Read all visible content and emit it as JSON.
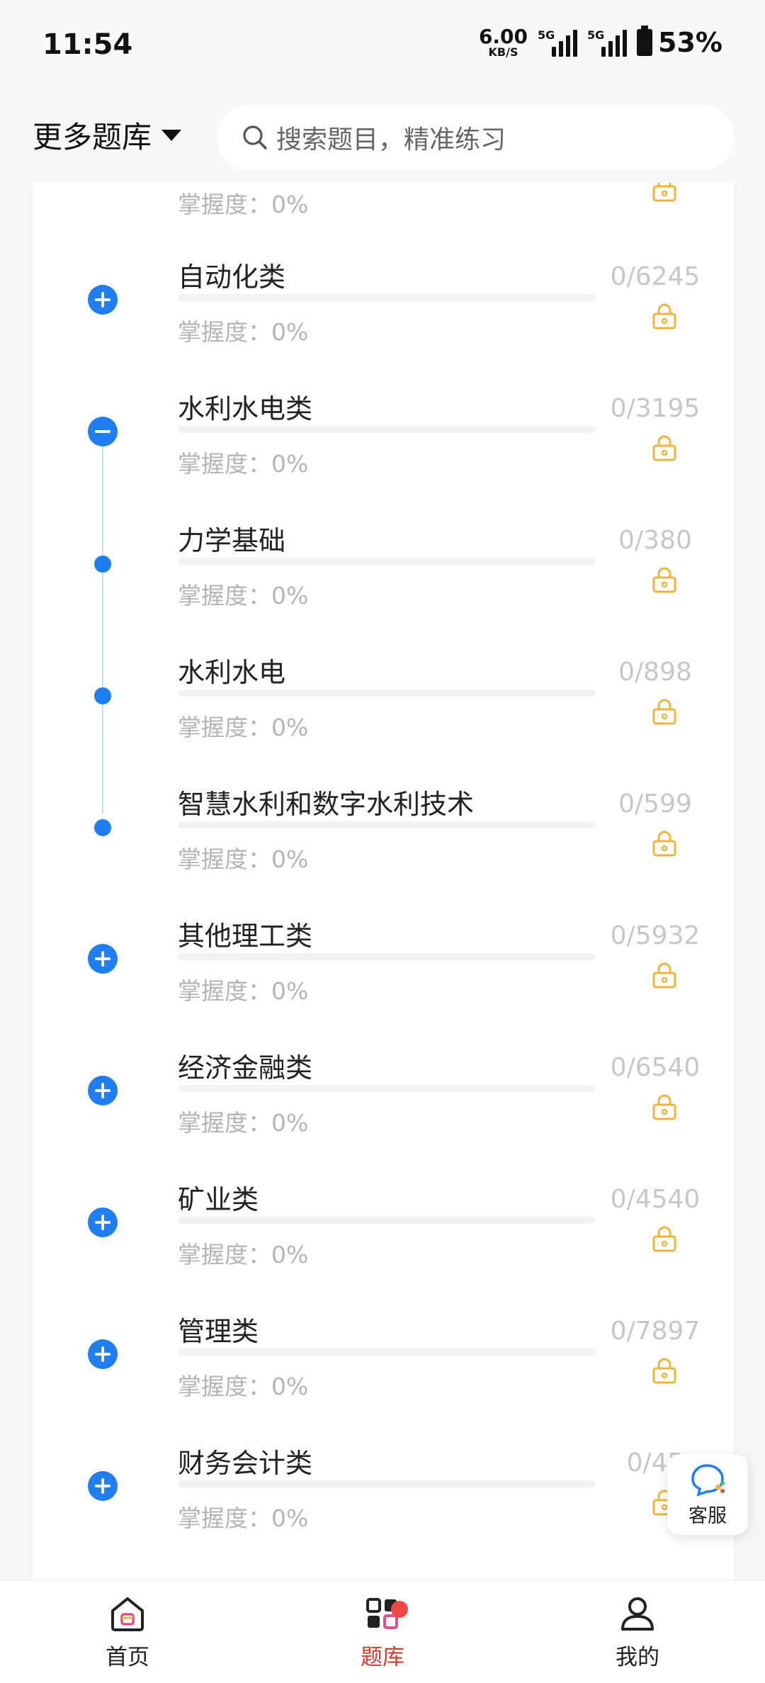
{
  "status_bar": {
    "time": "11:54",
    "net_speed_value": "6.00",
    "net_speed_unit": "KB/S",
    "sim1": "5G",
    "sim2": "5G",
    "battery": "53%"
  },
  "header": {
    "library_label": "更多题库",
    "search_placeholder": "搜索题目，精准练习"
  },
  "list": {
    "partial_top": {
      "mastery": "掌握度：0%"
    },
    "items": [
      {
        "title": "自动化类",
        "count": "0/6245",
        "mastery": "掌握度：0%",
        "progress": 0
      },
      {
        "title": "水利水电类",
        "count": "0/3195",
        "mastery": "掌握度：0%",
        "progress": 0
      },
      {
        "title": "力学基础",
        "count": "0/380",
        "mastery": "掌握度：0%",
        "progress": 0
      },
      {
        "title": "水利水电",
        "count": "0/898",
        "mastery": "掌握度：0%",
        "progress": 0
      },
      {
        "title": "智慧水利和数字水利技术",
        "count": "0/599",
        "mastery": "掌握度：0%",
        "progress": 0
      },
      {
        "title": "其他理工类",
        "count": "0/5932",
        "mastery": "掌握度：0%",
        "progress": 0
      },
      {
        "title": "经济金融类",
        "count": "0/6540",
        "mastery": "掌握度：0%",
        "progress": 0
      },
      {
        "title": "矿业类",
        "count": "0/4540",
        "mastery": "掌握度：0%",
        "progress": 0
      },
      {
        "title": "管理类",
        "count": "0/7897",
        "mastery": "掌握度：0%",
        "progress": 0
      },
      {
        "title": "财务会计类",
        "count": "0/45",
        "mastery": "掌握度：0%",
        "progress": 0
      }
    ]
  },
  "service": {
    "label": "客服"
  },
  "tabbar": {
    "home": "首页",
    "library": "题库",
    "mine": "我的"
  },
  "colors": {
    "accent": "#1e7ef2",
    "lock": "#f0b43c",
    "active_tab": "#d43a2e",
    "badge": "#f04848"
  }
}
